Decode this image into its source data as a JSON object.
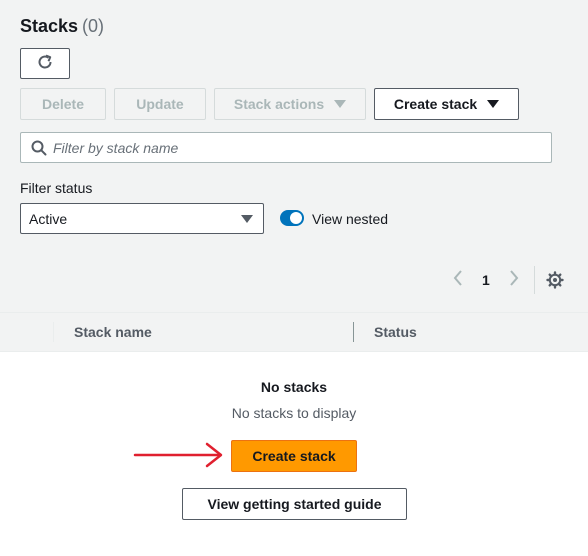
{
  "header": {
    "title": "Stacks",
    "count": "(0)"
  },
  "toolbar": {
    "delete_label": "Delete",
    "update_label": "Update",
    "stack_actions_label": "Stack actions",
    "create_stack_label": "Create stack"
  },
  "search": {
    "placeholder": "Filter by stack name",
    "value": ""
  },
  "filter": {
    "label": "Filter status",
    "selected": "Active",
    "view_nested_label": "View nested",
    "view_nested_on": true
  },
  "pagination": {
    "current_page": "1"
  },
  "table": {
    "columns": [
      "Stack name",
      "Status"
    ]
  },
  "empty_state": {
    "title": "No stacks",
    "description": "No stacks to display",
    "create_label": "Create stack",
    "guide_label": "View getting started guide"
  },
  "colors": {
    "primary": "#ff9900",
    "toggle": "#0073bb",
    "annotation_arrow": "#e0202f"
  }
}
